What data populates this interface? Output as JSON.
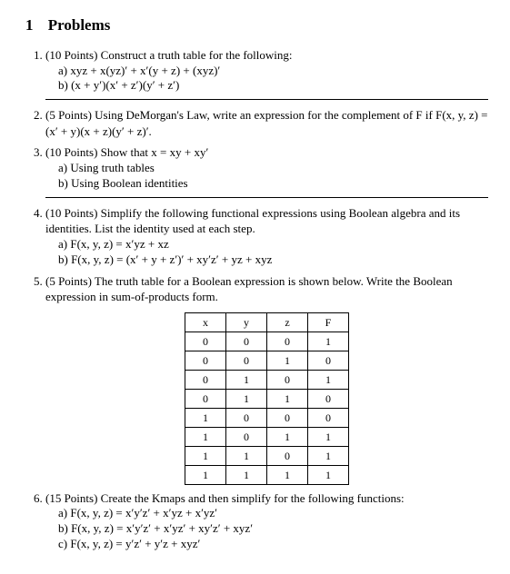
{
  "heading": {
    "number": "1",
    "title": "Problems"
  },
  "p1": {
    "intro": "(10 Points) Construct a truth table for the following:",
    "a": "a) xyz + x(yz)′ + x′(y + z) + (xyz)′",
    "b": "b) (x + y′)(x′ + z′)(y′ + z′)"
  },
  "p2": {
    "text": "(5 Points) Using DeMorgan's Law, write an expression for the complement of F if F(x, y, z) = (x′ + y)(x + z)(y′ + z)′."
  },
  "p3": {
    "intro": "(10 Points) Show that x = xy + xy′",
    "a": "a) Using truth tables",
    "b": "b) Using Boolean identities"
  },
  "p4": {
    "intro": "(10 Points) Simplify the following functional expressions using Boolean algebra and its identities.  List the identity used at each step.",
    "a": "a) F(x, y, z) = x′yz + xz",
    "b": "b) F(x, y, z) = (x′ + y + z′)′ + xy′z′ + yz + xyz"
  },
  "p5": {
    "intro": "(5 Points) The truth table for a Boolean expression is shown below.  Write the Boolean expression in sum-of-products form.",
    "headers": [
      "x",
      "y",
      "z",
      "F"
    ],
    "rows": [
      [
        "0",
        "0",
        "0",
        "1"
      ],
      [
        "0",
        "0",
        "1",
        "0"
      ],
      [
        "0",
        "1",
        "0",
        "1"
      ],
      [
        "0",
        "1",
        "1",
        "0"
      ],
      [
        "1",
        "0",
        "0",
        "0"
      ],
      [
        "1",
        "0",
        "1",
        "1"
      ],
      [
        "1",
        "1",
        "0",
        "1"
      ],
      [
        "1",
        "1",
        "1",
        "1"
      ]
    ]
  },
  "p6": {
    "intro": "(15 Points) Create the Kmaps and then simplify for the following functions:",
    "a": "a) F(x, y, z) = x′y′z′ + x′yz + x′yz′",
    "b": "b) F(x, y, z) = x′y′z′ + x′yz′ + xy′z′ + xyz′",
    "c": "c) F(x, y, z) = y′z′ + y′z + xyz′"
  },
  "chart_data": {
    "type": "table",
    "title": "Truth table for Boolean expression (Problem 5)",
    "columns": [
      "x",
      "y",
      "z",
      "F"
    ],
    "rows": [
      [
        0,
        0,
        0,
        1
      ],
      [
        0,
        0,
        1,
        0
      ],
      [
        0,
        1,
        0,
        1
      ],
      [
        0,
        1,
        1,
        0
      ],
      [
        1,
        0,
        0,
        0
      ],
      [
        1,
        0,
        1,
        1
      ],
      [
        1,
        1,
        0,
        1
      ],
      [
        1,
        1,
        1,
        1
      ]
    ]
  }
}
